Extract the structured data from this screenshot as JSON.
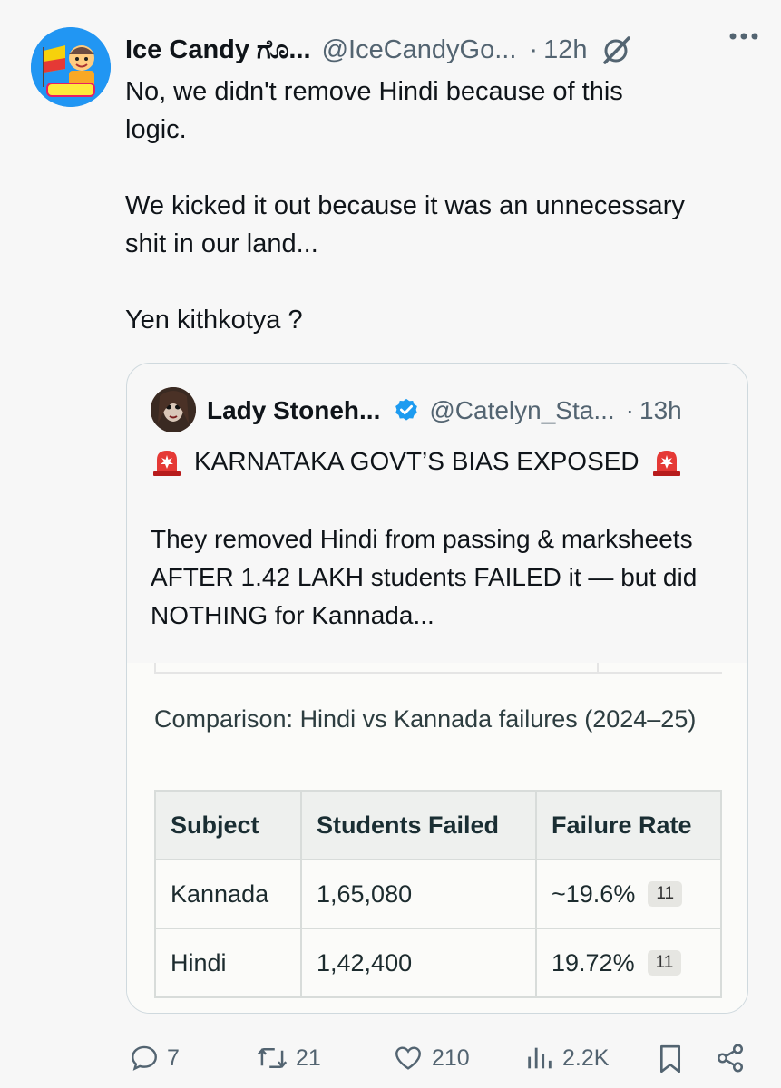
{
  "tweet": {
    "author_name": "Ice Candy ಗೊ...",
    "author_handle": "@IceCandyGo...",
    "separator": "·",
    "time": "12h",
    "text": "No, we didn't remove Hindi because of this\nlogic.\n\nWe kicked it out because it was an unnecessary\nshit in our land...\n\nYen kithkotya ?",
    "avatar_icon": "avatar-logo-icon",
    "grok_icon": "grok-icon",
    "more_icon": "more-icon"
  },
  "quote": {
    "author_name": "Lady Stoneh...",
    "author_handle": "@Catelyn_Sta...",
    "separator": "·",
    "time": "13h",
    "verified_icon": "verified-badge-icon",
    "headline": "KARNATAKA GOVT’S BIAS EXPOSED",
    "siren_icon": "siren-icon",
    "body": "They removed Hindi from passing & marksheets AFTER 1.42 LAKH students FAILED it — but did NOTHING for Kannada...",
    "embed": {
      "title": "Comparison: Hindi vs Kannada failures (2024–25)",
      "columns": [
        "Subject",
        "Students Failed",
        "Failure Rate"
      ],
      "rows": [
        {
          "subject": "Kannada",
          "failed": "1,65,080",
          "rate": "~19.6%",
          "ref": "11"
        },
        {
          "subject": "Hindi",
          "failed": "1,42,400",
          "rate": "19.72%",
          "ref": "11"
        }
      ]
    }
  },
  "actions": {
    "replies": "7",
    "reposts": "21",
    "likes": "210",
    "views": "2.2K",
    "reply_icon": "reply-icon",
    "repost_icon": "repost-icon",
    "like_icon": "heart-icon",
    "views_icon": "views-icon",
    "bookmark_icon": "bookmark-icon",
    "share_icon": "share-icon"
  },
  "colors": {
    "text": "#0f1419",
    "muted": "#536471",
    "verified": "#1d9bf0",
    "siren": "#e0245e",
    "border": "#cfd9de"
  }
}
